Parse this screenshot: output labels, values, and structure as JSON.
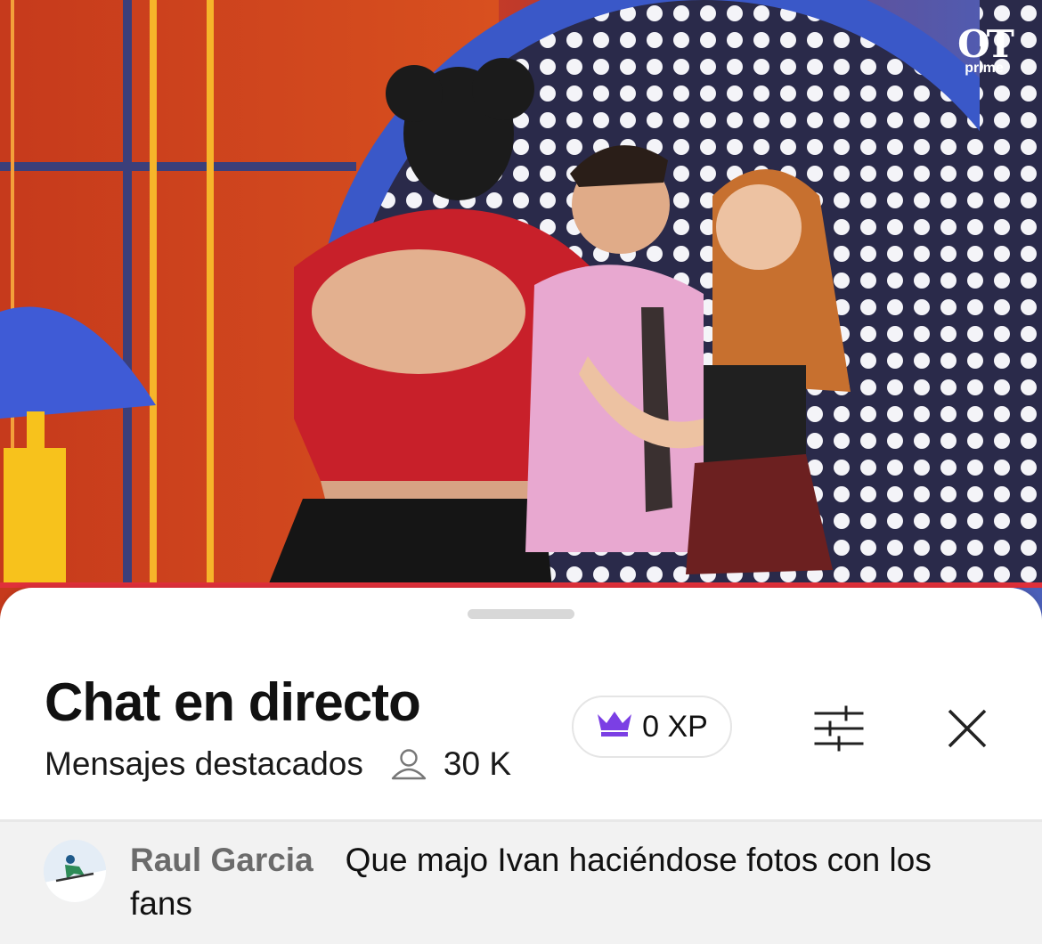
{
  "video": {
    "logo_text": "OT",
    "logo_sub": "prime"
  },
  "chat": {
    "title": "Chat en directo",
    "subtitle": "Mensajes destacados",
    "viewers": "30 K",
    "xp": "0 XP",
    "icons": {
      "crown": "crown-icon",
      "viewers": "user-icon",
      "filter": "sliders-icon",
      "close": "close-icon"
    },
    "accent_color": "#7b3fe4"
  },
  "messages": [
    {
      "author": "Raul Garcia",
      "text": "Que majo Ivan haciéndose fotos con los fans"
    }
  ]
}
